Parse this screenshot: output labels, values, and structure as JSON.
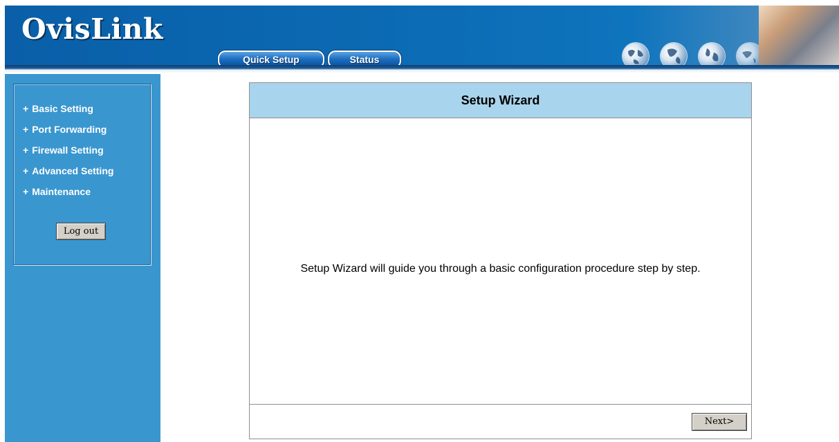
{
  "header": {
    "logo_text": "OvisLink",
    "nav": {
      "quick_setup": "Quick Setup",
      "status": "Status"
    }
  },
  "sidebar": {
    "items": [
      {
        "label": "Basic Setting"
      },
      {
        "label": "Port Forwarding"
      },
      {
        "label": "Firewall Setting"
      },
      {
        "label": "Advanced Setting"
      },
      {
        "label": "Maintenance"
      }
    ],
    "bullet": "+",
    "logout_label": "Log out"
  },
  "main": {
    "title": "Setup Wizard",
    "description": "Setup Wizard will guide you through a basic configuration procedure step by step.",
    "next_label": "Next>"
  },
  "colors": {
    "header_blue": "#0b6ab3",
    "sidebar_blue": "#3a96cf",
    "panel_title_bg": "#a9d4ed"
  },
  "icons": [
    "globe-icon",
    "globe-icon",
    "globe-icon",
    "globe-icon"
  ]
}
